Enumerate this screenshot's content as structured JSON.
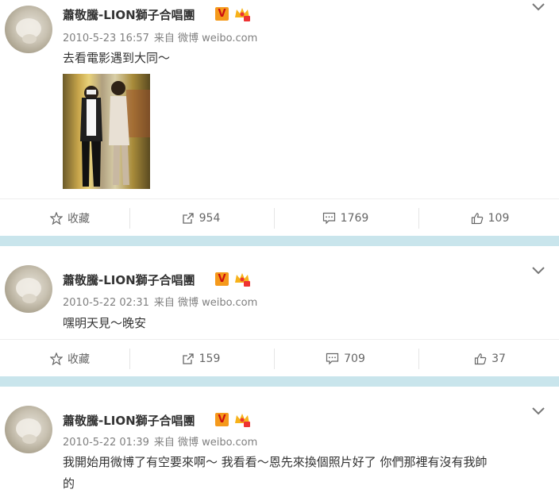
{
  "posts": [
    {
      "author": "蕭敬騰-LION獅子合唱團",
      "verified": "V",
      "date": "2010-5-23 16:57",
      "source": "来自 微博 weibo.com",
      "text": "去看電影遇到大同～",
      "has_image": true,
      "actions": {
        "favorite": "收藏",
        "repost": "954",
        "comment": "1769",
        "like": "109"
      }
    },
    {
      "author": "蕭敬騰-LION獅子合唱團",
      "verified": "V",
      "date": "2010-5-22 02:31",
      "source": "来自 微博 weibo.com",
      "text": "嘿明天見～晚安",
      "has_image": false,
      "actions": {
        "favorite": "收藏",
        "repost": "159",
        "comment": "709",
        "like": "37"
      }
    },
    {
      "author": "蕭敬騰-LION獅子合唱團",
      "verified": "V",
      "date": "2010-5-22 01:39",
      "source": "来自 微博 weibo.com",
      "text_line1": "我開始用微博了有空要來啊～ 我看看～恩先來換個照片好了 你們那裡有沒有我帥",
      "text_line2": "的",
      "has_image": false
    }
  ],
  "colors": {
    "background": "#c9e5ec",
    "badge": "#f59a1c",
    "text": "#333333",
    "meta": "#808080"
  }
}
